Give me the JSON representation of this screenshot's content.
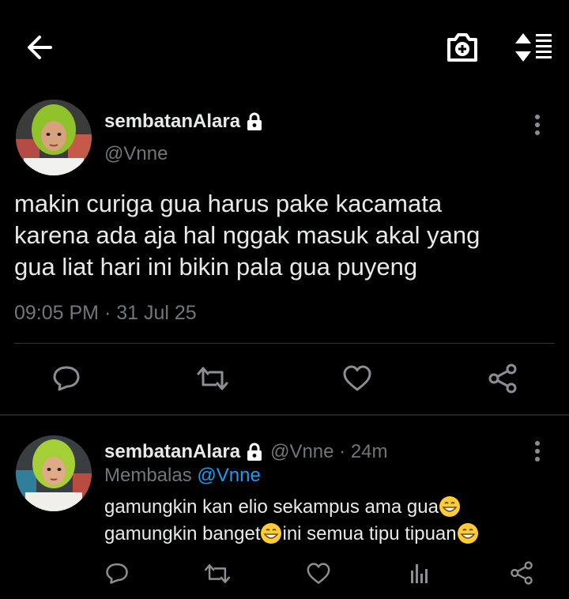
{
  "header": {
    "back_icon": "arrow-left-icon",
    "camera_icon": "camera-plus-icon",
    "sort_icon": "sort-lines-icon"
  },
  "tweet": {
    "display_name": "sembatanAlara",
    "handle": "@Vnne",
    "text": "makin curiga gua harus pake kacamata\nkarena ada aja hal nggak masuk akal yang\ngua liat hari ini bikin pala gua puyeng",
    "timestamp": "09:05 PM · 31 Jul 25",
    "actions": [
      "reply-icon",
      "retweet-icon",
      "like-icon",
      "share-icon"
    ]
  },
  "reply": {
    "display_name": "sembatanAlara",
    "handle_time": "@Vnne · 24m",
    "replying_prefix": "Membalas",
    "replying_mention": "@Vnne",
    "line1": "gamungkin kan elio sekampus ama gua",
    "line2a": "gamungkin banget",
    "line2b": "ini semua tipu tipuan",
    "actions": [
      "reply-icon",
      "retweet-icon",
      "like-icon",
      "analytics-icon",
      "share-icon"
    ]
  },
  "colors": {
    "background": "#000000",
    "text": "#e7e9ea",
    "muted": "#71767b",
    "link": "#1d9bf0",
    "divider": "#2f3336"
  }
}
